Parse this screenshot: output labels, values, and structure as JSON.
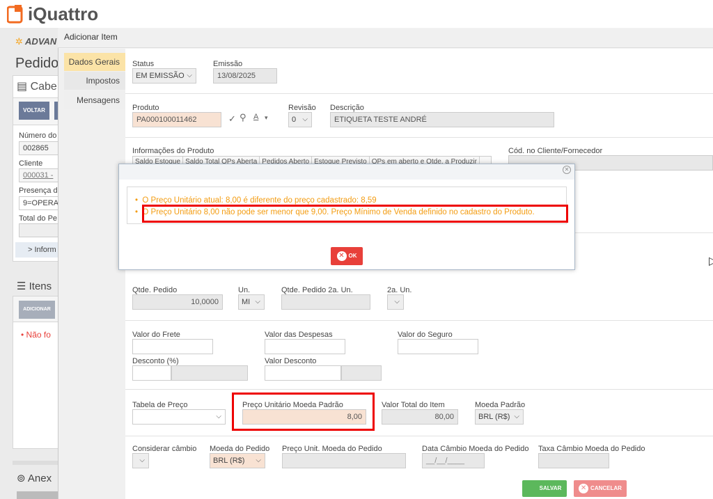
{
  "app": {
    "brand": "iQuattro",
    "sub_brand": "ADVAN"
  },
  "background": {
    "page_title": "Pedido",
    "section_header": "Cabe",
    "voltar_label": "VOLTAR",
    "numero_label": "Número do",
    "numero_value": "002865",
    "cliente_label": "Cliente",
    "cliente_value": "000031 -",
    "presenca_label": "Presença do",
    "presenca_value": "9=OPERA",
    "total_label": "Total do Pe",
    "info_link": "> Inform",
    "itens_header": "Itens",
    "adicionar_label": "ADICIONAR",
    "nao_found": "Não fo",
    "anexos_header": "Anex"
  },
  "modal": {
    "title": "Adicionar Item",
    "tabs": [
      {
        "label": "Dados Gerais"
      },
      {
        "label": "Impostos"
      },
      {
        "label": "Mensagens"
      }
    ],
    "status": {
      "label": "Status",
      "value": "EM EMISSÃO"
    },
    "emissao": {
      "label": "Emissão",
      "value": "13/08/2025"
    },
    "produto": {
      "label": "Produto",
      "value": "PA000100011462"
    },
    "revisao": {
      "label": "Revisão",
      "value": "0"
    },
    "descricao": {
      "label": "Descrição",
      "value": "ETIQUETA TESTE ANDRÉ"
    },
    "info_produto": {
      "label": "Informações do Produto",
      "columns": [
        "Saldo Estoque",
        "Saldo Total OPs Aberta",
        "Pedidos Aberto",
        "Estoque Previsto",
        "OPs em aberto e Qtde. a Produzir"
      ]
    },
    "cod_cliente": {
      "label": "Cód. no Cliente/Fornecedor"
    },
    "qtde_pedido": {
      "label": "Qtde. Pedido",
      "value": "10,0000"
    },
    "un": {
      "label": "Un.",
      "value": "MI"
    },
    "qtde_2a": {
      "label": "Qtde. Pedido 2a. Un."
    },
    "un_2a": {
      "label": "2a. Un."
    },
    "frete": {
      "label": "Valor do Frete"
    },
    "despesas": {
      "label": "Valor das Despesas"
    },
    "seguro": {
      "label": "Valor do Seguro"
    },
    "desconto_pct": {
      "label": "Desconto (%)"
    },
    "desconto_val": {
      "label": "Valor Desconto"
    },
    "tabela_preco": {
      "label": "Tabela de Preço"
    },
    "preco_unit": {
      "label": "Preço Unitário Moeda Padrão",
      "value": "8,00"
    },
    "valor_total": {
      "label": "Valor Total do Item",
      "value": "80,00"
    },
    "moeda_padrao": {
      "label": "Moeda Padrão",
      "value": "BRL (R$)"
    },
    "considerar_cambio": {
      "label": "Considerar câmbio"
    },
    "moeda_pedido": {
      "label": "Moeda do Pedido",
      "value": "BRL (R$)"
    },
    "preco_moeda_pedido": {
      "label": "Preço Unit. Moeda do Pedido"
    },
    "data_cambio": {
      "label": "Data Câmbio Moeda do Pedido",
      "placeholder": "__/__/____"
    },
    "taxa_cambio": {
      "label": "Taxa Câmbio Moeda do Pedido"
    },
    "salvar_label": "SALVAR",
    "cancelar_label": "CANCELAR"
  },
  "alert": {
    "messages": [
      "O Preço Unitário atual: 8,00 é diferente do preço cadastrado: 8,59",
      "O Preço Unitário 8,00 não pode ser menor que 9,00. Preço Mínimo de Venda definido no cadastro do Produto."
    ],
    "ok_label": "OK"
  },
  "colors": {
    "accent": "#fbe3a7",
    "warning": "#f39c12",
    "danger": "#e8403a",
    "success": "#5cb85c"
  }
}
